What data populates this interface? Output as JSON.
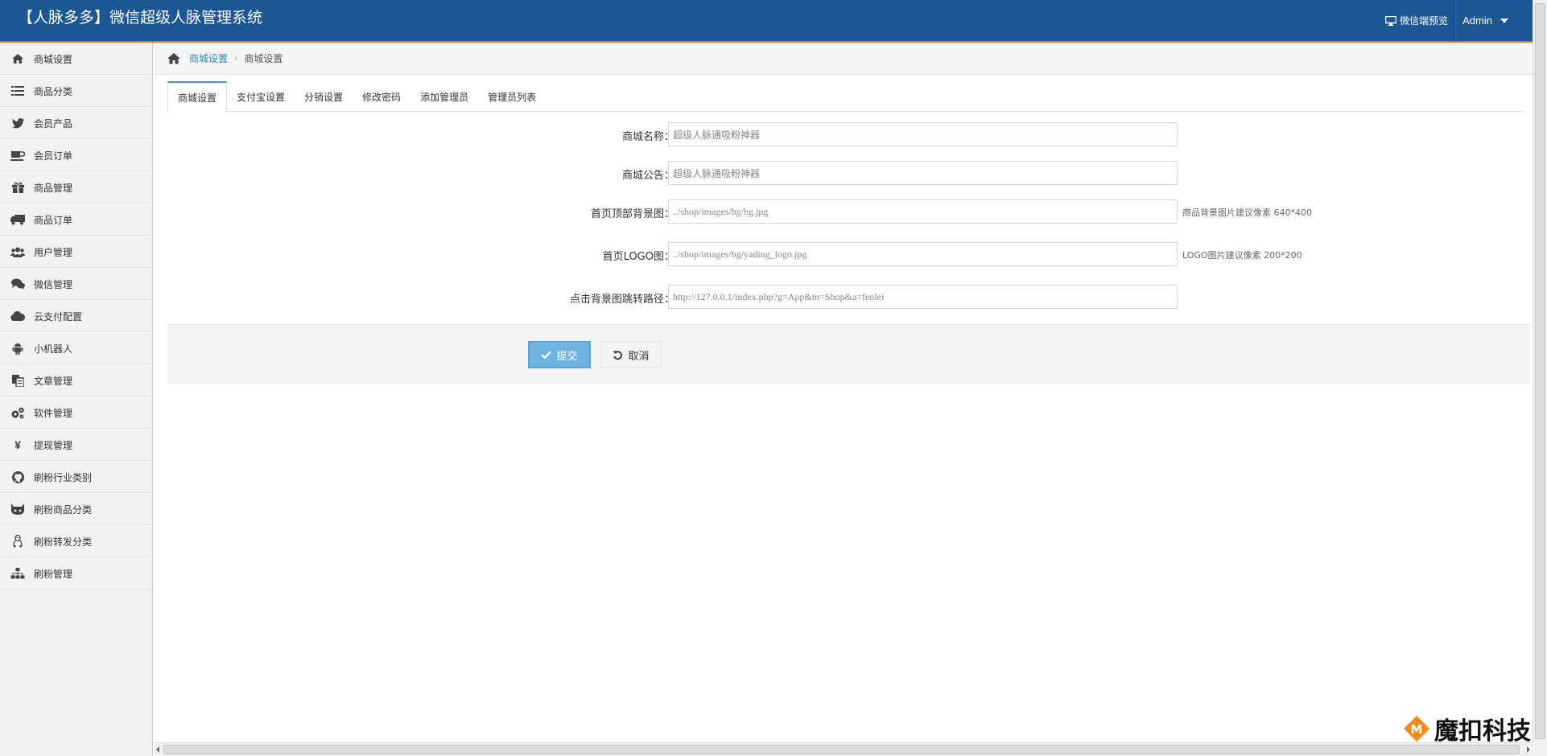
{
  "header": {
    "brand": "【人脉多多】微信超级人脉管理系统",
    "preview_label": "微信端预览",
    "user_label": "Admin"
  },
  "sidebar": {
    "items": [
      {
        "label": "商城设置",
        "icon": "home-icon"
      },
      {
        "label": "商品分类",
        "icon": "list-icon"
      },
      {
        "label": "会员产品",
        "icon": "twitter-icon"
      },
      {
        "label": "会员订单",
        "icon": "coffee-icon"
      },
      {
        "label": "商品管理",
        "icon": "gift-icon"
      },
      {
        "label": "商品订单",
        "icon": "truck-icon"
      },
      {
        "label": "用户管理",
        "icon": "users-icon"
      },
      {
        "label": "微信管理",
        "icon": "comments-icon"
      },
      {
        "label": "云支付配置",
        "icon": "cloud-icon"
      },
      {
        "label": "小机器人",
        "icon": "android-icon"
      },
      {
        "label": "文章管理",
        "icon": "copy-icon"
      },
      {
        "label": "软件管理",
        "icon": "cogs-icon"
      },
      {
        "label": "提现管理",
        "icon": "yen-icon"
      },
      {
        "label": "刷粉行业类别",
        "icon": "github-icon"
      },
      {
        "label": "刷粉商品分类",
        "icon": "gitlab-icon"
      },
      {
        "label": "刷粉转发分类",
        "icon": "linux-icon"
      },
      {
        "label": "刷粉管理",
        "icon": "sitemap-icon"
      }
    ]
  },
  "breadcrumb": {
    "link": "商城设置",
    "current": "商城设置"
  },
  "tabs": [
    "商城设置",
    "支付宝设置",
    "分销设置",
    "修改密码",
    "添加管理员",
    "管理员列表"
  ],
  "form": {
    "fields": [
      {
        "label": "商城名称：",
        "value": "超级人脉通吸粉神器",
        "help": ""
      },
      {
        "label": "商城公告：",
        "value": "超级人脉通吸粉神器",
        "help": ""
      },
      {
        "label": "首页顶部背景图：",
        "value": "../shop/images/bg/bg.jpg",
        "help": "商品背景图片建议像素 640*400"
      },
      {
        "label": "首页LOGO图：",
        "value": "../shop/images/bg/yading_logo.jpg",
        "help": "LOGO图片建议像素 200*200"
      },
      {
        "label": "点击背景图跳转路径：",
        "value": "http://127.0.0.1/index.php?g=App&m=Shop&a=fenlei",
        "help": ""
      }
    ],
    "submit_label": "提交",
    "cancel_label": "取消"
  },
  "watermark": {
    "text": "魔扣科技",
    "logo_letter": "M"
  },
  "colors": {
    "navbar": "#1c5795",
    "navbar_accent": "#e0731d",
    "link": "#2a8ab8",
    "submit": "#6fb3e0"
  }
}
